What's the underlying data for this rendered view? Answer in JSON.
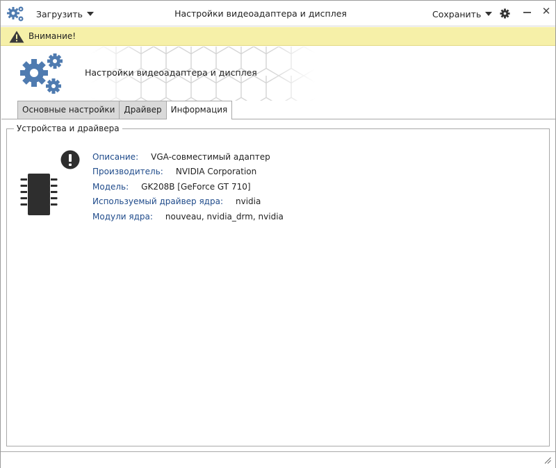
{
  "titlebar": {
    "load_label": "Загрузить",
    "title": "Настройки видеоадаптера и дисплея",
    "save_label": "Сохранить",
    "close_glyph": "✕"
  },
  "warning": {
    "text": "Внимание!",
    "color": "#f6f0a8"
  },
  "header": {
    "title": "Настройки видеоадаптера и дисплея"
  },
  "tabs": [
    {
      "label": "Основные настройки",
      "active": false
    },
    {
      "label": "Драйвер",
      "active": false
    },
    {
      "label": "Информация",
      "active": true
    }
  ],
  "group": {
    "title": "Устройства и драйвера",
    "rows": [
      {
        "label": "Описание:",
        "value": "VGA-совместимый адаптер"
      },
      {
        "label": "Производитель:",
        "value": "NVIDIA Corporation"
      },
      {
        "label": "Модель:",
        "value": "GK208B [GeForce GT 710]"
      },
      {
        "label": "Используемый драйвер ядра:",
        "value": "nvidia"
      },
      {
        "label": "Модули ядра:",
        "value": "nouveau, nvidia_drm, nvidia"
      }
    ]
  },
  "icons": {
    "app": "gears-icon",
    "settings": "gear-icon",
    "warning": "warning-triangle-icon",
    "device": "chip-icon",
    "alert": "exclamation-circle-icon"
  },
  "colors": {
    "accent": "#4f7bb0",
    "label": "#1e4a8a"
  }
}
